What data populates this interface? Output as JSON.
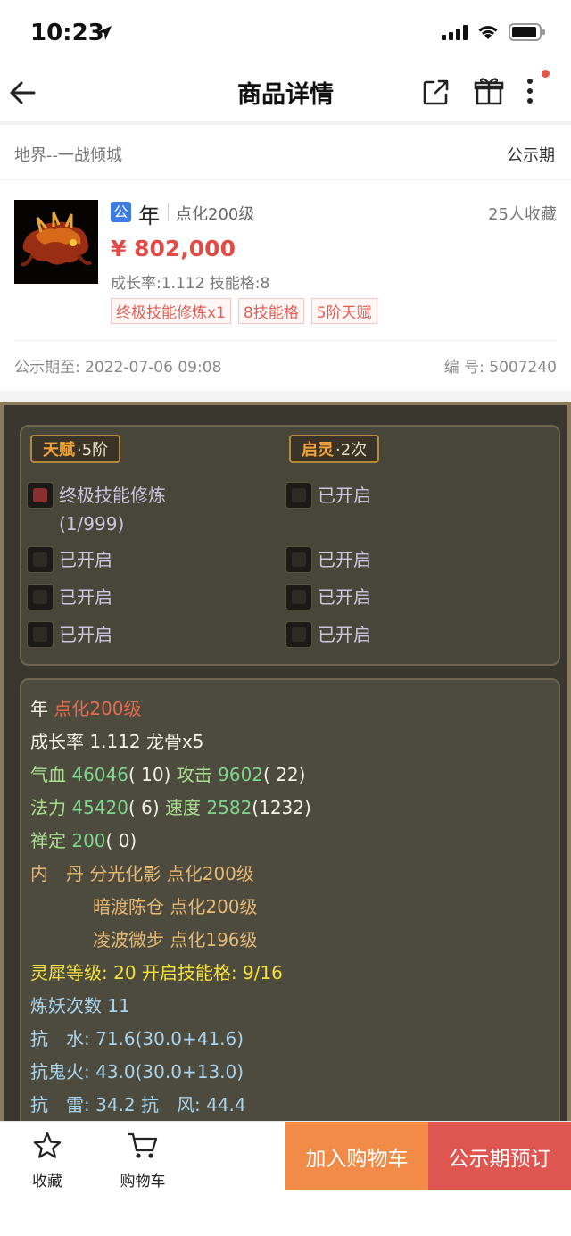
{
  "status_bar": {
    "time": "10:23"
  },
  "navbar": {
    "title": "商品详情"
  },
  "server": {
    "name": "地界--一战倾城",
    "status": "公示期"
  },
  "product": {
    "badge": "公",
    "name": "年",
    "level": "点化200级",
    "favorites": "25人收藏",
    "price": "¥ 802,000",
    "attrs": "成长率:1.112 技能格:8",
    "tags": [
      "终极技能修炼x1",
      "8技能格",
      "5阶天赋"
    ],
    "pubdate": "公示期至: 2022-07-06 09:08",
    "serial": "编 号: 5007240"
  },
  "talent": {
    "left_key": "天赋",
    "left_val": "·5阶",
    "right_key": "启灵",
    "right_val": "·2次",
    "left_slots": [
      "终极技能修炼",
      "(1/999)",
      "已开启",
      "已开启",
      "已开启"
    ],
    "right_slots": [
      "已开启",
      "已开启",
      "已开启",
      "已开启"
    ]
  },
  "stats": {
    "l1a": "年",
    "l1b": "点化200级",
    "l2": "成长率 1.112 龙骨x5",
    "l3a": "气血",
    "l3b": "46046",
    "l3c": "( 10)",
    "l3d": "攻击",
    "l3e": "9602",
    "l3f": "( 22)",
    "l4a": "法力",
    "l4b": "45420",
    "l4c": "( 6)",
    "l4d": "速度",
    "l4e": "2582",
    "l4f": "(1232)",
    "l5a": "禅定",
    "l5b": "200",
    "l5c": "( 0)",
    "l6": "内　丹 分光化影 点化200级",
    "l7": "暗渡陈仓 点化200级",
    "l8": "凌波微步 点化196级",
    "l9": "灵犀等级: 20 开启技能格: 9/16",
    "l10": "炼妖次数 11",
    "l11": "抗　水: 71.6(30.0+41.6)",
    "l12": "抗鬼火: 43.0(30.0+13.0)",
    "l13": "抗　雷: 34.2 抗　风: 44.4"
  },
  "bottom": {
    "fav_label": "收藏",
    "cart_label": "购物车",
    "add_cart": "加入购物车",
    "reserve": "公示期预订"
  }
}
